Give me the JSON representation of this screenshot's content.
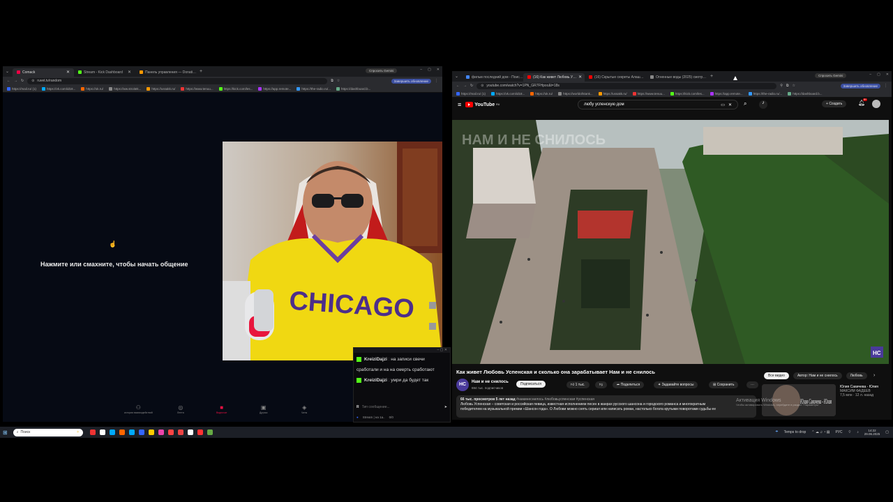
{
  "left_window": {
    "tabs": [
      {
        "label": "Comaсk",
        "color": "#e04"
      },
      {
        "label": "Stream - Kick Dashboard",
        "color": "#53fc18"
      },
      {
        "label": "Панель управления — Donati…",
        "color": "#f90"
      }
    ],
    "gemini": "Спросить Gemini",
    "url": "ruvet.tv/random",
    "update": "Завершить обновление",
    "bookmarks": [
      "https://mail.ru/ (1)",
      "https://vk.com/id18...",
      "https://ok.ru/",
      "https://ww.stroitek...",
      "https://ussakk.ru/",
      "https://www.tenuu...",
      "https://kick.com/les...",
      "https://app.remote...",
      "https://the-radio.ru/...",
      "https://dashboard.b..."
    ],
    "prompt": "Нажмите или смахните, чтобы начать общение",
    "shirt_text": "CHICAGO",
    "bottom_nav": [
      "история взаимодействий",
      "Лента",
      "Видеочат",
      "Друзья",
      "Чаты"
    ]
  },
  "chat": {
    "messages": [
      {
        "user": "KreiziDajzi",
        "text": "на записи свечи сработали и на на смерть сработают"
      },
      {
        "user": "KreiziDajzi",
        "text": "умри да будет так"
      }
    ],
    "placeholder": "Тип сообщение...",
    "stream_bar": "Stream | на 1а..",
    "stream_stat": "0/0"
  },
  "right_window": {
    "tabs": [
      {
        "label": "фильм последний дом - Поис…",
        "color": "#4285f4"
      },
      {
        "label": "(16) Как живет Любовь У…",
        "color": "#f00"
      },
      {
        "label": "(16) Скрытые секреты Алаш…",
        "color": "#f00"
      },
      {
        "label": "Огненные воды (2025) смотр…",
        "color": "#888"
      }
    ],
    "gemini": "Спросить Gemini",
    "url": "youtube.com/watch?v=1PN_GR7FHpoc&t=18s",
    "update": "Завершить обновление",
    "bookmarks": [
      "https://mail.ru/ (1)",
      "https://vk.com/id18...",
      "https://ok.ru/",
      "https://worldofstank...",
      "https://ussakk.ru/",
      "https://www.tenuu...",
      "https://kick.com/les...",
      "https://app.remote...",
      "https://the-radio.ru/...",
      "https://dashboard.b..."
    ],
    "yt_logo": "YouTube",
    "yt_region": "RU",
    "search": "любу успенскую дом",
    "create": "Создать",
    "notif_count": "9+",
    "video_overlay": "НАМ И НЕ СНИЛОСЬ",
    "channel_badge": "НС",
    "title": "Как живет Любовь Успенская и сколько она зарабатывает Нам и не снилось",
    "channel": "Нам и не снилось",
    "subs": "694 тыс. подписчиков",
    "subscribe": "Подписаться",
    "likes": "1 тыс.",
    "share": "Поделиться",
    "ask": "Задавайте вопросы",
    "save": "Сохранить",
    "chips": [
      "Все видео",
      "Автор: Нам и не снилось",
      "Любовь"
    ],
    "desc_meta": "66 тыс. просмотров  5 лет назад",
    "desc_tags": "#наминеснилось #любовьуспенская #успенская",
    "desc_line1": "Любовь Успенская – советская и российская певица, известная исполнением песен в жанрах русского шансона и городского романса и многократным",
    "desc_line2": "победителем на музыкальной премии «Шансон года». О Любови можно снять сериал или написать роман, настолько богата крутыми поворотами судьбы ее",
    "rec_title": "Юлия Савичева - Юлия",
    "rec_channel": "МАКСИМ ФАДЕЕВ",
    "rec_meta": "7,5 млн · 12 л. назад",
    "activation": "Активация Windows",
    "activation_sub": "Чтобы активировать Windows, перейдите в раздел \"Параметры\"."
  },
  "taskbar": {
    "search": "Поиск",
    "weather": "Temps to drop",
    "lang": "РУС",
    "time": "14:22",
    "date": "29.06.2025",
    "icon_colors": [
      "#e33",
      "#fff",
      "#0af",
      "#f60",
      "#0af",
      "#36f",
      "#fc0",
      "#e4a",
      "#f44",
      "#e44",
      "#fff",
      "#f33",
      "#6a4"
    ]
  }
}
